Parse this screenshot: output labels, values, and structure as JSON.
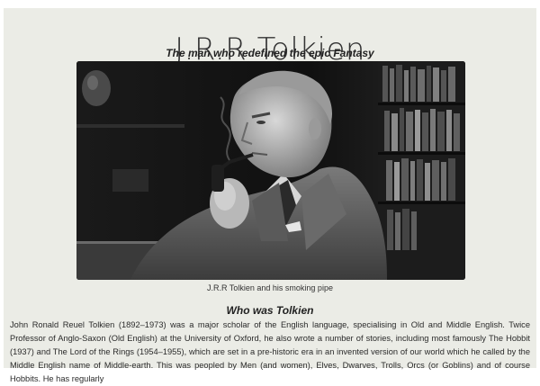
{
  "header": {
    "title": "J.R.R Tolkien",
    "subtitle": "The man who redefined the epic Fantasy"
  },
  "figure": {
    "image_icon": "portrait-photo",
    "caption": "J.R.R Tolkien and his smoking pipe"
  },
  "section": {
    "heading": "Who was Tolkien",
    "paragraph": "John Ronald Reuel Tolkien (1892–1973) was a major scholar of the English language, specialising in Old and Middle English. Twice Professor of Anglo-Saxon (Old English) at the University of Oxford, he also wrote a number of stories, including most famously The Hobbit (1937) and The Lord of the Rings (1954–1955), which are set in a pre-historic era in an invented version of our world which he called by the Middle English name of Middle-earth. This was peopled by Men (and women), Elves, Dwarves, Trolls, Orcs (or Goblins) and of course Hobbits. He has regularly"
  },
  "colors": {
    "page_background": "#ebece6",
    "text": "#222222"
  }
}
